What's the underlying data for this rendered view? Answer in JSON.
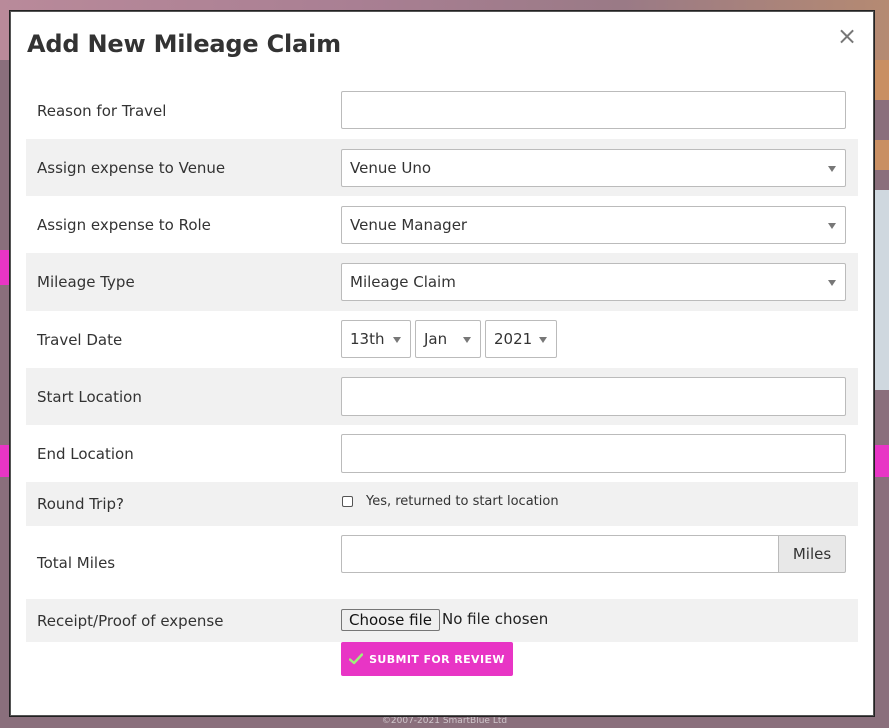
{
  "modal": {
    "title": "Add New Mileage Claim",
    "close_symbol": "×"
  },
  "form": {
    "reason": {
      "label": "Reason for Travel",
      "value": ""
    },
    "venue": {
      "label": "Assign expense to Venue",
      "value": "Venue Uno"
    },
    "role": {
      "label": "Assign expense to Role",
      "value": "Venue Manager"
    },
    "mileage_type": {
      "label": "Mileage Type",
      "value": "Mileage Claim"
    },
    "travel_date": {
      "label": "Travel Date",
      "day": "13th",
      "month": "Jan",
      "year": "2021"
    },
    "start_location": {
      "label": "Start Location",
      "value": ""
    },
    "end_location": {
      "label": "End Location",
      "value": ""
    },
    "round_trip": {
      "label": "Round Trip?",
      "checkbox_label": "Yes, returned to start location",
      "checked": false
    },
    "total_miles": {
      "label": "Total Miles",
      "unit": "Miles",
      "value": ""
    },
    "receipt": {
      "label": "Receipt/Proof of expense",
      "button": "Choose file",
      "status": "No file chosen"
    }
  },
  "submit": {
    "label": "SUBMIT FOR REVIEW",
    "icon": "check-icon"
  },
  "footer": {
    "copyright": "©2007-2021 SmartBlue Ltd"
  },
  "colors": {
    "accent": "#e835c5",
    "row_shade": "#f1f1f1"
  }
}
